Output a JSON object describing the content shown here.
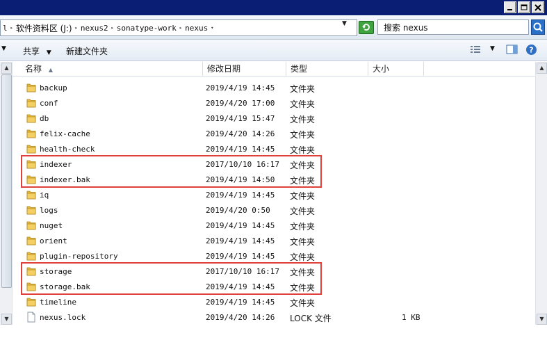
{
  "address": {
    "segments": [
      "软件资料区 (J:)",
      "nexus2",
      "sonatype-work",
      "nexus"
    ],
    "partial_prefix": "l"
  },
  "search": {
    "text": "搜索 nexus"
  },
  "toolbar": {
    "share_label": "共享",
    "new_folder_label": "新建文件夹"
  },
  "columns": {
    "name": "名称",
    "date": "修改日期",
    "type": "类型",
    "size": "大小"
  },
  "files": [
    {
      "name": "backup",
      "date": "2019/4/19 14:45",
      "type": "文件夹",
      "size": "",
      "icon": "folder-icon"
    },
    {
      "name": "conf",
      "date": "2019/4/20 17:00",
      "type": "文件夹",
      "size": "",
      "icon": "folder-icon"
    },
    {
      "name": "db",
      "date": "2019/4/19 15:47",
      "type": "文件夹",
      "size": "",
      "icon": "folder-icon"
    },
    {
      "name": "felix-cache",
      "date": "2019/4/20 14:26",
      "type": "文件夹",
      "size": "",
      "icon": "folder-icon"
    },
    {
      "name": "health-check",
      "date": "2019/4/19 14:45",
      "type": "文件夹",
      "size": "",
      "icon": "folder-icon"
    },
    {
      "name": "indexer",
      "date": "2017/10/10 16:17",
      "type": "文件夹",
      "size": "",
      "icon": "folder-icon"
    },
    {
      "name": "indexer.bak",
      "date": "2019/4/19 14:50",
      "type": "文件夹",
      "size": "",
      "icon": "folder-icon"
    },
    {
      "name": "iq",
      "date": "2019/4/19 14:45",
      "type": "文件夹",
      "size": "",
      "icon": "folder-icon"
    },
    {
      "name": "logs",
      "date": "2019/4/20 0:50",
      "type": "文件夹",
      "size": "",
      "icon": "folder-icon"
    },
    {
      "name": "nuget",
      "date": "2019/4/19 14:45",
      "type": "文件夹",
      "size": "",
      "icon": "folder-icon"
    },
    {
      "name": "orient",
      "date": "2019/4/19 14:45",
      "type": "文件夹",
      "size": "",
      "icon": "folder-icon"
    },
    {
      "name": "plugin-repository",
      "date": "2019/4/19 14:45",
      "type": "文件夹",
      "size": "",
      "icon": "folder-icon"
    },
    {
      "name": "storage",
      "date": "2017/10/10 16:17",
      "type": "文件夹",
      "size": "",
      "icon": "folder-icon"
    },
    {
      "name": "storage.bak",
      "date": "2019/4/19 14:45",
      "type": "文件夹",
      "size": "",
      "icon": "folder-icon"
    },
    {
      "name": "timeline",
      "date": "2019/4/19 14:45",
      "type": "文件夹",
      "size": "",
      "icon": "folder-icon"
    },
    {
      "name": "nexus.lock",
      "date": "2019/4/20 14:26",
      "type": "LOCK 文件",
      "size": "1 KB",
      "icon": "file-icon"
    }
  ],
  "highlight_groups": [
    [
      "indexer",
      "indexer.bak"
    ],
    [
      "storage",
      "storage.bak"
    ]
  ],
  "colors": {
    "titlebar": "#0a1e74",
    "highlight": "#e0403c",
    "folder": "#e8b93a"
  }
}
